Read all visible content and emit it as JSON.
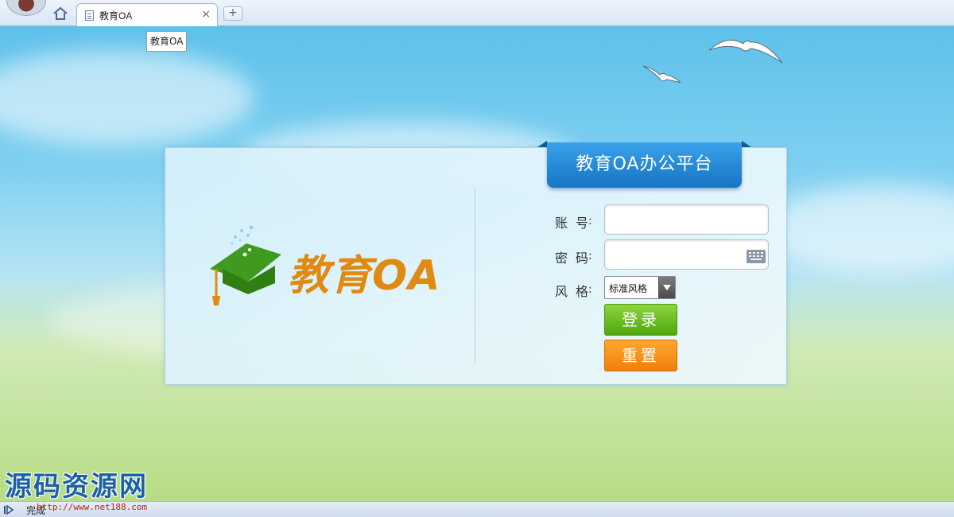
{
  "browser": {
    "tab_title": "教育OA",
    "tab_close": "×",
    "new_tab": "+",
    "tooltip": "教育OA",
    "status_text": "完成"
  },
  "login": {
    "platform_title": "教育OA办公平台",
    "logo_text": "教育OA",
    "account_label": "账号",
    "password_label": "密码",
    "style_label": "风格",
    "colon": ":",
    "account_value": "",
    "password_value": "",
    "style_selected": "标准风格",
    "login_button": "登录",
    "reset_button": "重置"
  },
  "watermark": {
    "text": "源码资源网",
    "url": "http://www.net188.com"
  },
  "colors": {
    "ribbon": "#1f84d6",
    "logo_text": "#e08a12",
    "login_button": "#6cbf1f",
    "reset_button": "#f58f10"
  }
}
